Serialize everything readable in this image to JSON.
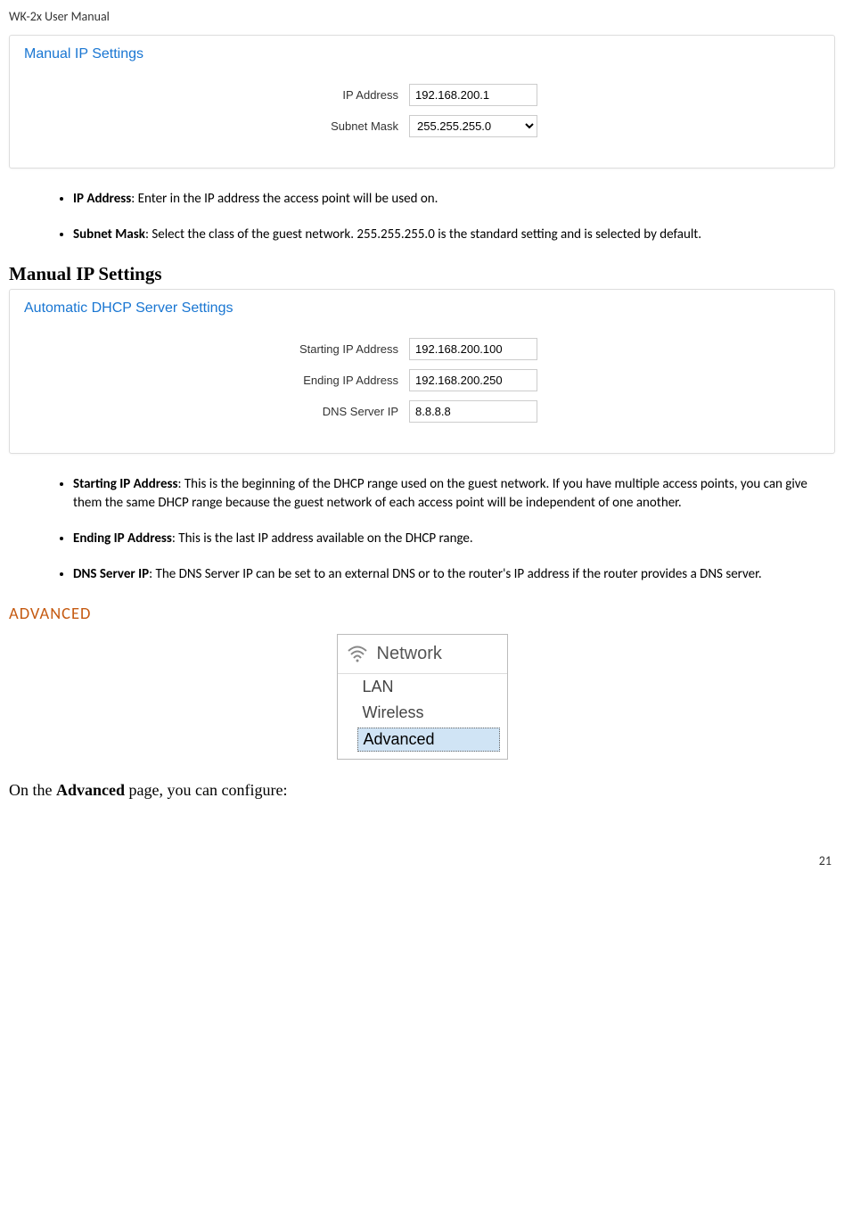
{
  "header": "WK-2x User Manual",
  "panel1": {
    "title": "Manual IP Settings",
    "ip_label": "IP Address",
    "ip_value": "192.168.200.1",
    "mask_label": "Subnet Mask",
    "mask_value": "255.255.255.0"
  },
  "bullets1": {
    "b1_bold": "IP Address",
    "b1_text": ": Enter in the IP address the access point will be used on.",
    "b2_bold": "Subnet Mask",
    "b2_text": ": Select the class of the guest network. 255.255.255.0 is the standard setting and is selected by default."
  },
  "section_heading": "Manual IP Settings",
  "panel2": {
    "title": "Automatic DHCP Server Settings",
    "start_label": "Starting IP Address",
    "start_value": "192.168.200.100",
    "end_label": "Ending IP Address",
    "end_value": "192.168.200.250",
    "dns_label": "DNS Server IP",
    "dns_value": "8.8.8.8"
  },
  "bullets2": {
    "b1_bold": "Starting IP Address",
    "b1_text": ": This is the beginning of the DHCP range used on the guest network. If you have multiple access points, you can give them the same DHCP range because the guest network of each access point will be independent of one another.",
    "b2_bold": "Ending IP Address",
    "b2_text": ": This is the last IP address available on the DHCP range.",
    "b3_bold": "DNS Server IP",
    "b3_text": ": The DNS Server IP can be set to an external DNS or to the router's IP address if the router provides a DNS server."
  },
  "advanced_heading": "ADVANCED",
  "menu": {
    "header": "Network",
    "item1": "LAN",
    "item2": "Wireless",
    "item3": "Advanced"
  },
  "body_text_1": "On the ",
  "body_text_bold": "Advanced",
  "body_text_2": " page, you can configure:",
  "page_number": "21"
}
